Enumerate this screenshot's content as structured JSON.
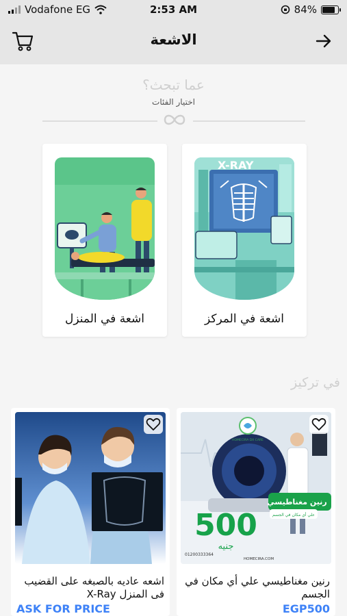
{
  "status": {
    "carrier": "Vodafone EG",
    "time": "2:53 AM",
    "battery": "84%",
    "battery_level": 0.84
  },
  "header": {
    "title": "الاشعة",
    "cart_icon": "cart-icon",
    "back_icon": "arrow-right-icon"
  },
  "search": {
    "title": "عما تبحث؟",
    "caption": "اختيار الفئات"
  },
  "categories": [
    {
      "label": "اشعة في المنزل",
      "badge": ""
    },
    {
      "label": "اشعة في المركز",
      "badge": "X-RAY"
    }
  ],
  "focus": {
    "title": "في تركيز"
  },
  "products": [
    {
      "name": "اشعه عاديه بالصبغه على القضيب فى المنزل X-Ray",
      "price": "ASK FOR PRICE"
    },
    {
      "name": "رنين مغناطيسي علي أي مكان في الجسم",
      "price": "EGP500",
      "promo": {
        "logo_text": "HOMECIRA DX CARE",
        "banner_title": "رنين مغناطيسي",
        "banner_sub": "علي أي مكان في الجسم",
        "big_number": "500",
        "currency_word": "جنيه",
        "phone": "01200333364",
        "site": "HOMECIRA.COM"
      }
    }
  ],
  "colors": {
    "accent": "#3e82f7",
    "header_bg": "#e6e6e6",
    "illus_green": "#5bc58a"
  }
}
